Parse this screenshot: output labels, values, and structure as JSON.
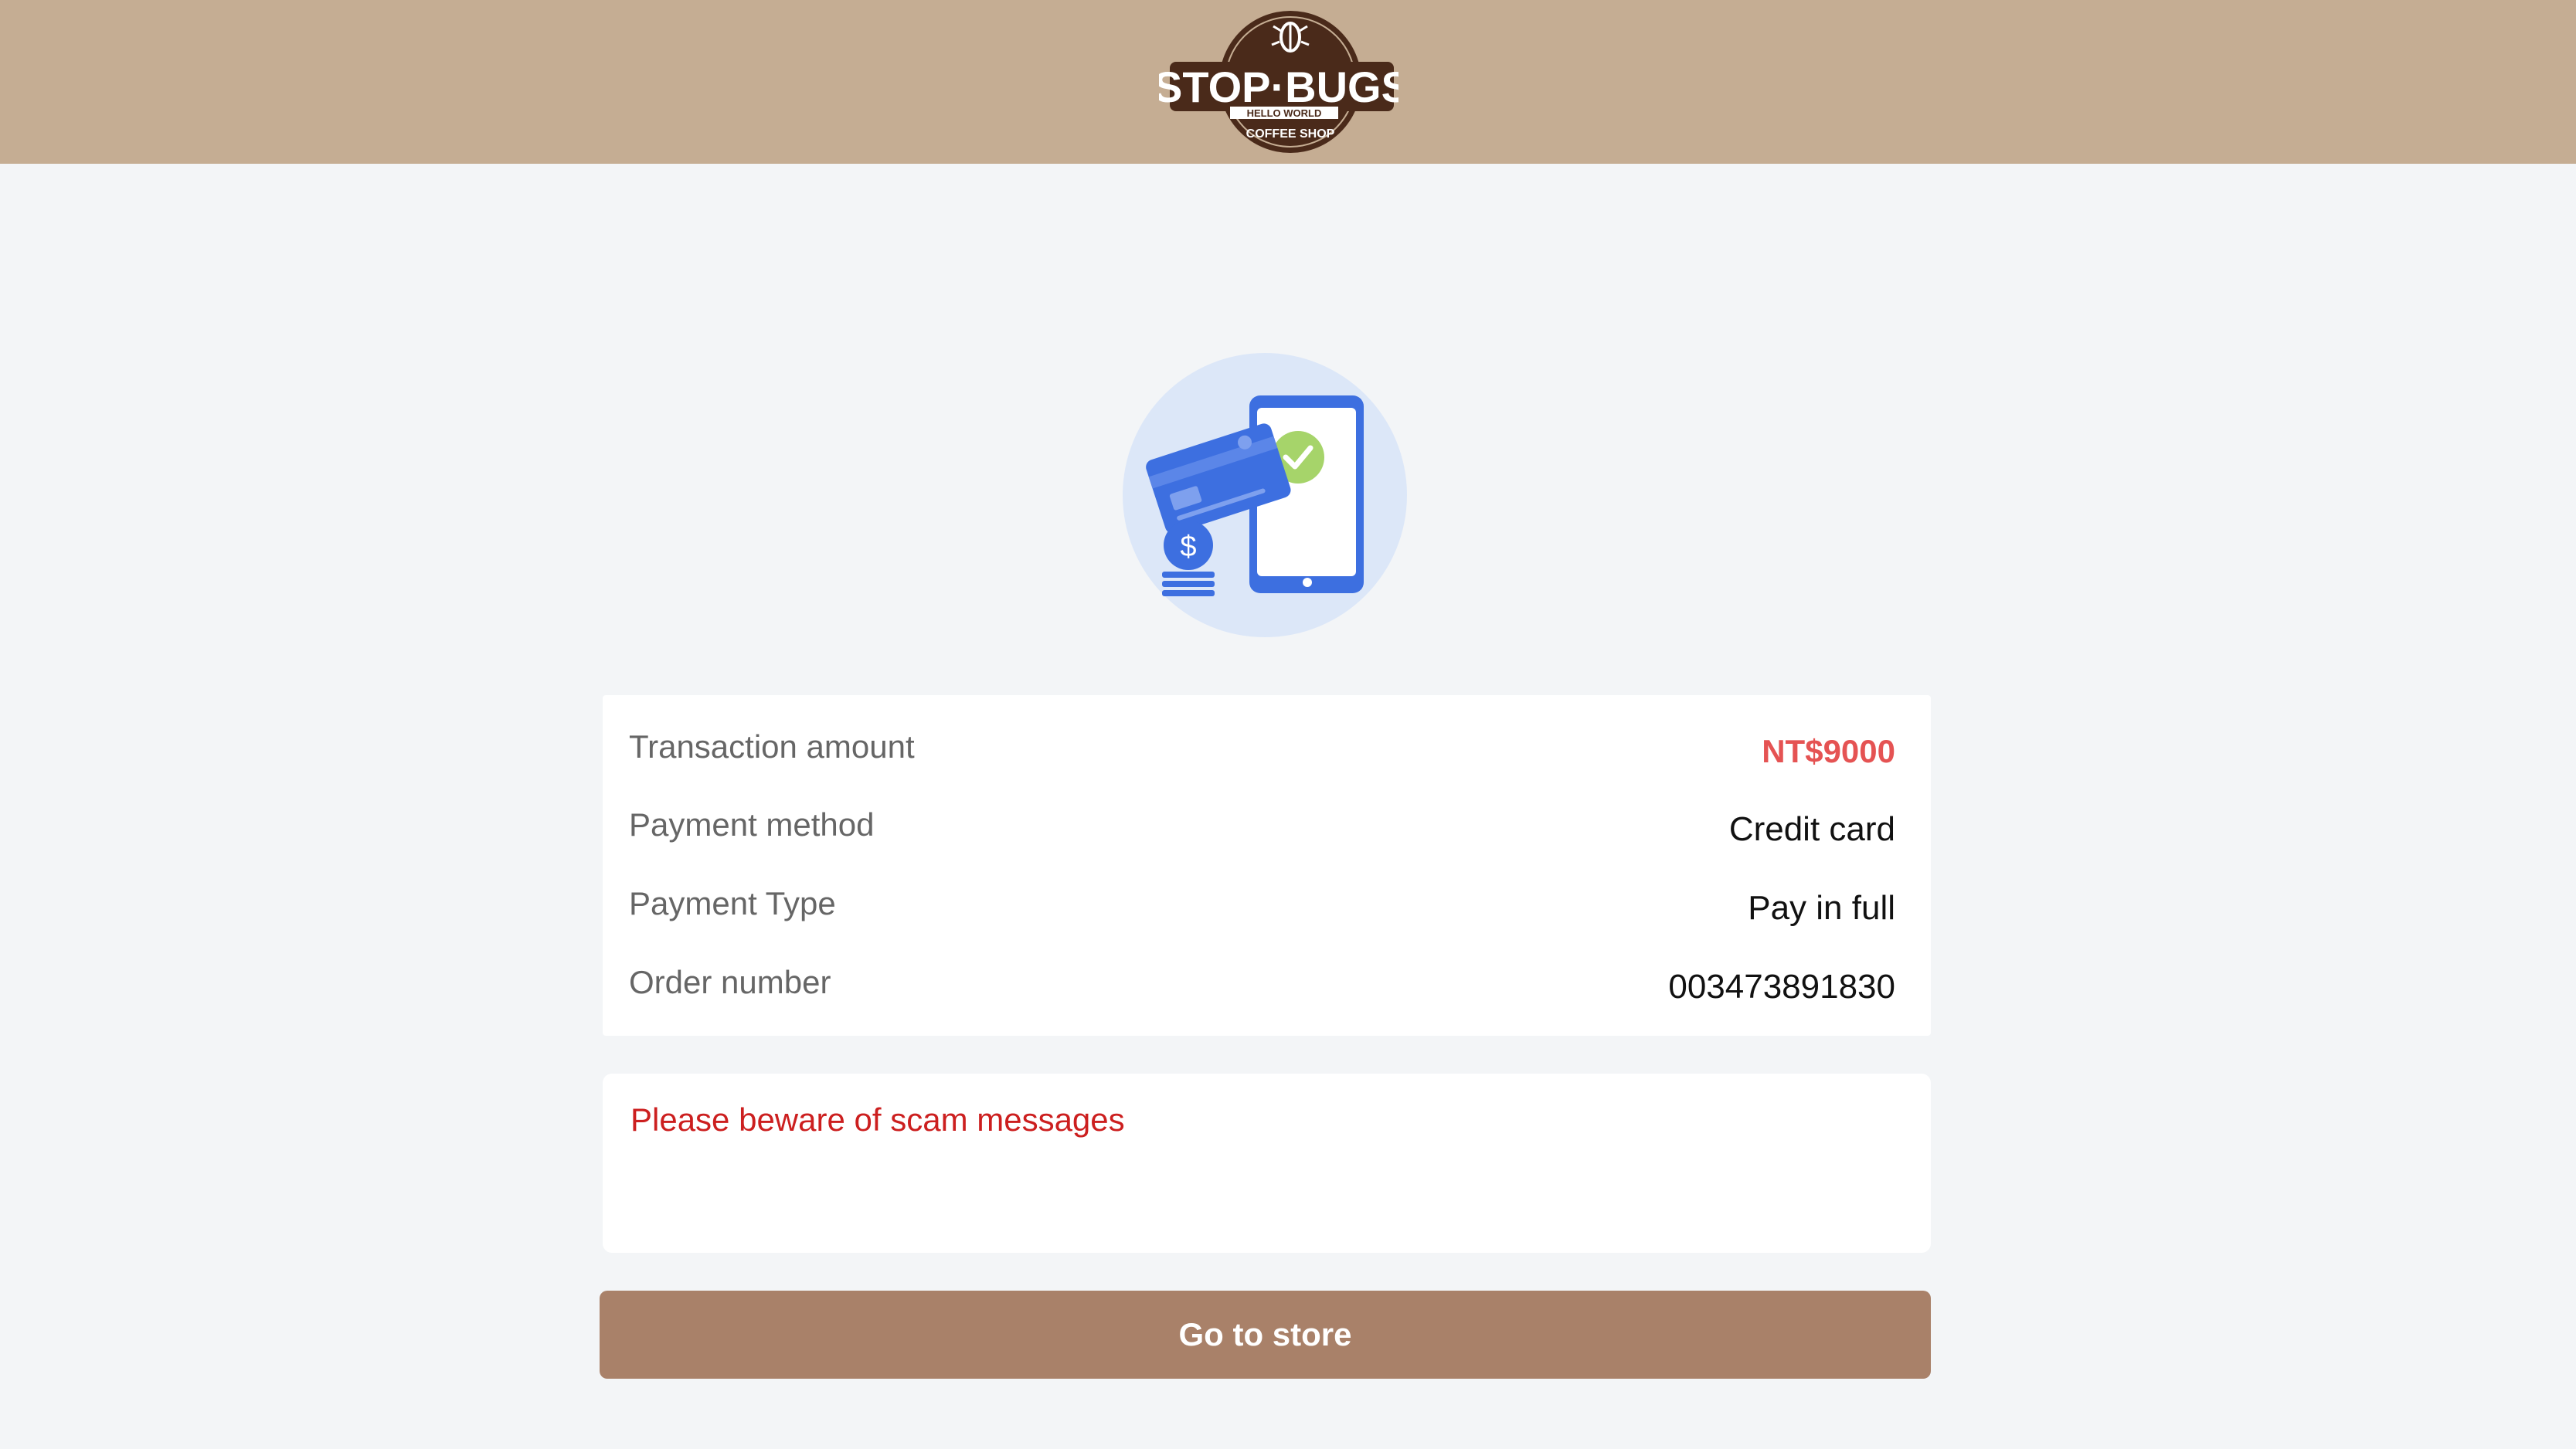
{
  "header": {
    "logo": {
      "brand_text": "STOP·BUGS",
      "tagline": "HELLO WORLD",
      "subtitle": "COFFEE SHOP",
      "icon": "bug-icon"
    },
    "background_color": "#c5ad93"
  },
  "illustration": {
    "icon": "mobile-payment-success-icon"
  },
  "transaction": {
    "rows": [
      {
        "label": "Transaction amount",
        "value": "NT$9000"
      },
      {
        "label": "Payment method",
        "value": "Credit card"
      },
      {
        "label": "Payment Type",
        "value": "Pay in full"
      },
      {
        "label": "Order number",
        "value": "003473891830"
      }
    ]
  },
  "notice": {
    "text": "Please beware of scam messages"
  },
  "actions": {
    "go_to_store_label": "Go to store"
  },
  "colors": {
    "amount": "#e55353",
    "notice": "#cc1f1f",
    "button": "#a98169",
    "background": "#f3f5f7"
  }
}
